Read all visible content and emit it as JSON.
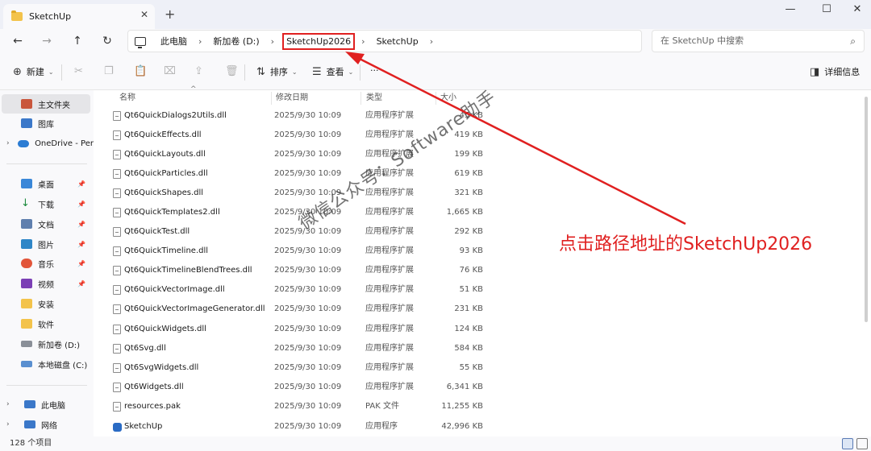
{
  "window": {
    "tab_title": "SketchUp",
    "tab_close": "✕",
    "new_tab": "+",
    "minimize": "—",
    "maximize": "☐",
    "close": "✕"
  },
  "nav": {
    "back": "←",
    "forward": "→",
    "up": "↑",
    "refresh": "↻",
    "breadcrumb": [
      "此电脑",
      "新加卷 (D:)",
      "SketchUp2026",
      "SketchUp"
    ],
    "separator": "›",
    "search_placeholder": "在 SketchUp 中搜索",
    "search_icon": "⌕"
  },
  "toolbar": {
    "new_label": "新建",
    "sort_label": "排序",
    "view_label": "查看",
    "more_label": "···",
    "details_label": "详细信息"
  },
  "sidebar": {
    "home": "主文件夹",
    "gallery": "图库",
    "onedrive": "OneDrive - Per",
    "desktop": "桌面",
    "downloads": "下载",
    "documents": "文档",
    "pictures": "图片",
    "music": "音乐",
    "videos": "视频",
    "install": "安装",
    "software": "软件",
    "drive_d": "新加卷 (D:)",
    "drive_c": "本地磁盘 (C:)",
    "this_pc": "此电脑",
    "network": "网络",
    "pin_icon": "📌"
  },
  "columns": {
    "name": "名称",
    "modified": "修改日期",
    "type": "类型",
    "size": "大小"
  },
  "files": [
    {
      "name": "Qt6QuickDialogs2Utils.dll",
      "date": "2025/9/30 10:09",
      "type": "应用程序扩展",
      "size": "45 KB"
    },
    {
      "name": "Qt6QuickEffects.dll",
      "date": "2025/9/30 10:09",
      "type": "应用程序扩展",
      "size": "419 KB"
    },
    {
      "name": "Qt6QuickLayouts.dll",
      "date": "2025/9/30 10:09",
      "type": "应用程序扩展",
      "size": "199 KB"
    },
    {
      "name": "Qt6QuickParticles.dll",
      "date": "2025/9/30 10:09",
      "type": "应用程序扩展",
      "size": "619 KB"
    },
    {
      "name": "Qt6QuickShapes.dll",
      "date": "2025/9/30 10:09",
      "type": "应用程序扩展",
      "size": "321 KB"
    },
    {
      "name": "Qt6QuickTemplates2.dll",
      "date": "2025/9/30 10:09",
      "type": "应用程序扩展",
      "size": "1,665 KB"
    },
    {
      "name": "Qt6QuickTest.dll",
      "date": "2025/9/30 10:09",
      "type": "应用程序扩展",
      "size": "292 KB"
    },
    {
      "name": "Qt6QuickTimeline.dll",
      "date": "2025/9/30 10:09",
      "type": "应用程序扩展",
      "size": "93 KB"
    },
    {
      "name": "Qt6QuickTimelineBlendTrees.dll",
      "date": "2025/9/30 10:09",
      "type": "应用程序扩展",
      "size": "76 KB"
    },
    {
      "name": "Qt6QuickVectorImage.dll",
      "date": "2025/9/30 10:09",
      "type": "应用程序扩展",
      "size": "51 KB"
    },
    {
      "name": "Qt6QuickVectorImageGenerator.dll",
      "date": "2025/9/30 10:09",
      "type": "应用程序扩展",
      "size": "231 KB"
    },
    {
      "name": "Qt6QuickWidgets.dll",
      "date": "2025/9/30 10:09",
      "type": "应用程序扩展",
      "size": "124 KB"
    },
    {
      "name": "Qt6Svg.dll",
      "date": "2025/9/30 10:09",
      "type": "应用程序扩展",
      "size": "584 KB"
    },
    {
      "name": "Qt6SvgWidgets.dll",
      "date": "2025/9/30 10:09",
      "type": "应用程序扩展",
      "size": "55 KB"
    },
    {
      "name": "Qt6Widgets.dll",
      "date": "2025/9/30 10:09",
      "type": "应用程序扩展",
      "size": "6,341 KB"
    },
    {
      "name": "resources.pak",
      "date": "2025/9/30 10:09",
      "type": "PAK 文件",
      "size": "11,255 KB"
    },
    {
      "name": "SketchUp",
      "date": "2025/9/30 10:09",
      "type": "应用程序",
      "size": "42,996 KB"
    }
  ],
  "status": {
    "item_count": "128 个项目"
  },
  "overlay": {
    "watermark": "微信公众号：Software助手",
    "annotation": "点击路径地址的SketchUp2026",
    "annotation_color": "#e02020"
  }
}
